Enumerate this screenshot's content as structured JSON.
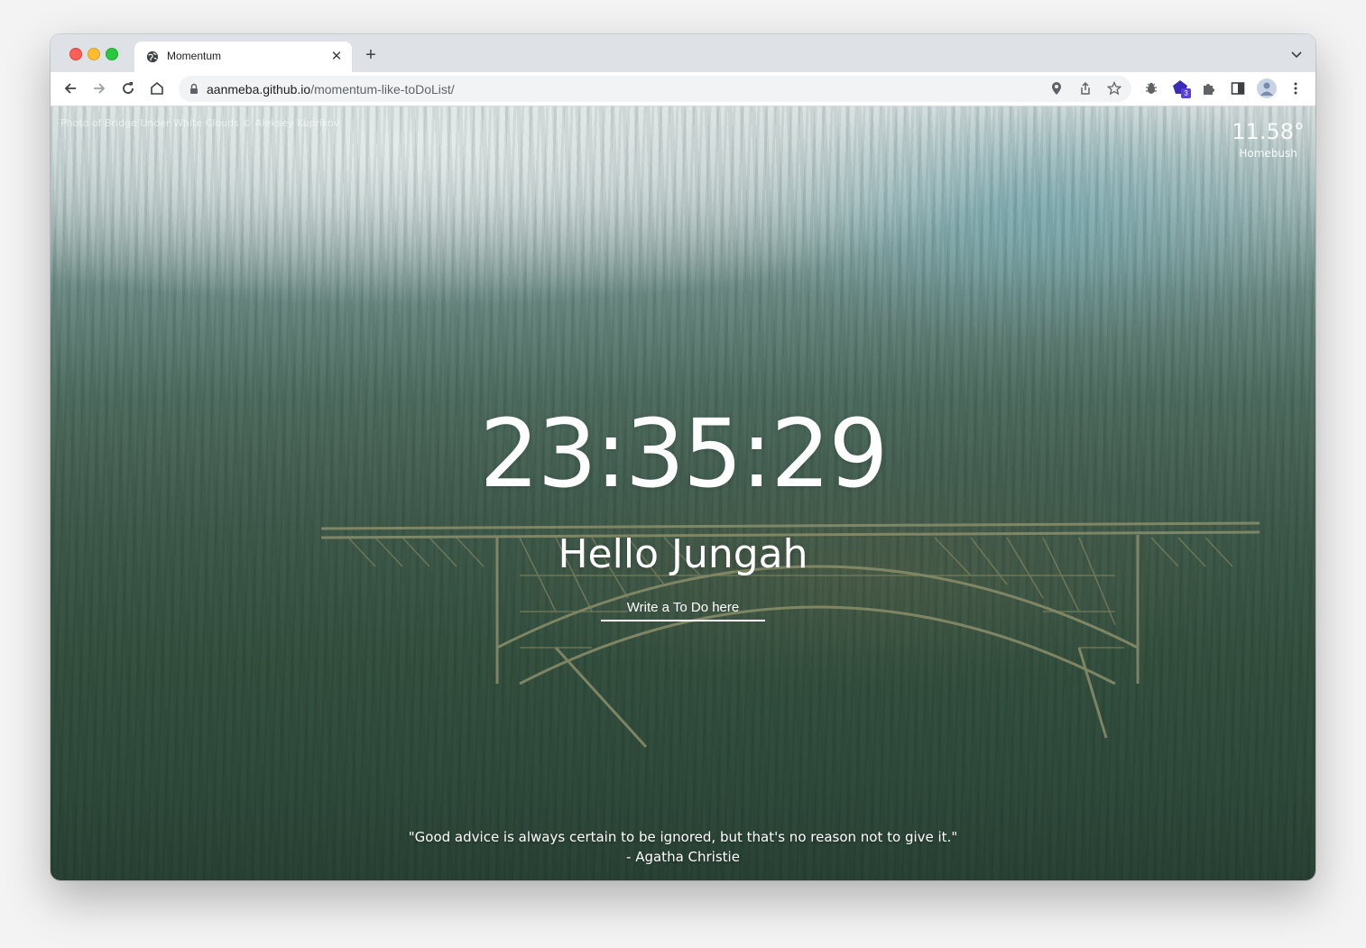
{
  "browser": {
    "tab": {
      "title": "Momentum",
      "favicon": "globe-icon",
      "close_icon": "close-icon"
    },
    "new_tab_icon": "plus-icon",
    "tab_list_icon": "chevron-down-icon",
    "nav": {
      "back_icon": "back-arrow-icon",
      "forward_icon": "forward-arrow-icon",
      "reload_icon": "reload-icon",
      "home_icon": "home-icon"
    },
    "address": {
      "domain": "aanmeba.github.io",
      "path": "/momentum-like-toDoList/",
      "lock_icon": "lock-icon"
    },
    "omnibox_icons": [
      "location-pin-icon",
      "share-icon",
      "star-icon"
    ],
    "extensions": [
      "bug-extension-icon",
      "extension-badge-icon",
      "puzzle-icon",
      "side-panel-icon",
      "profile-avatar",
      "kebab-menu-icon"
    ],
    "extension_badge_count": "3"
  },
  "page": {
    "photo_credit": "Photo of Bridge Under White Clouds © Aleksey Kuprikov",
    "weather": {
      "temperature": "11.58°",
      "city": "Homebush"
    },
    "clock": "23:35:29",
    "greeting": "Hello Jungah",
    "todo_placeholder": "Write a To Do here",
    "quote": {
      "text": "\"Good advice is always certain to be ignored, but that's no reason not to give it.\"",
      "author": "- Agatha Christie"
    }
  },
  "colors": {
    "tabstrip": "#dee1e6",
    "omnibox": "#f1f3f4",
    "badge": "#5a3fd8",
    "text_on_photo": "#ffffff"
  }
}
